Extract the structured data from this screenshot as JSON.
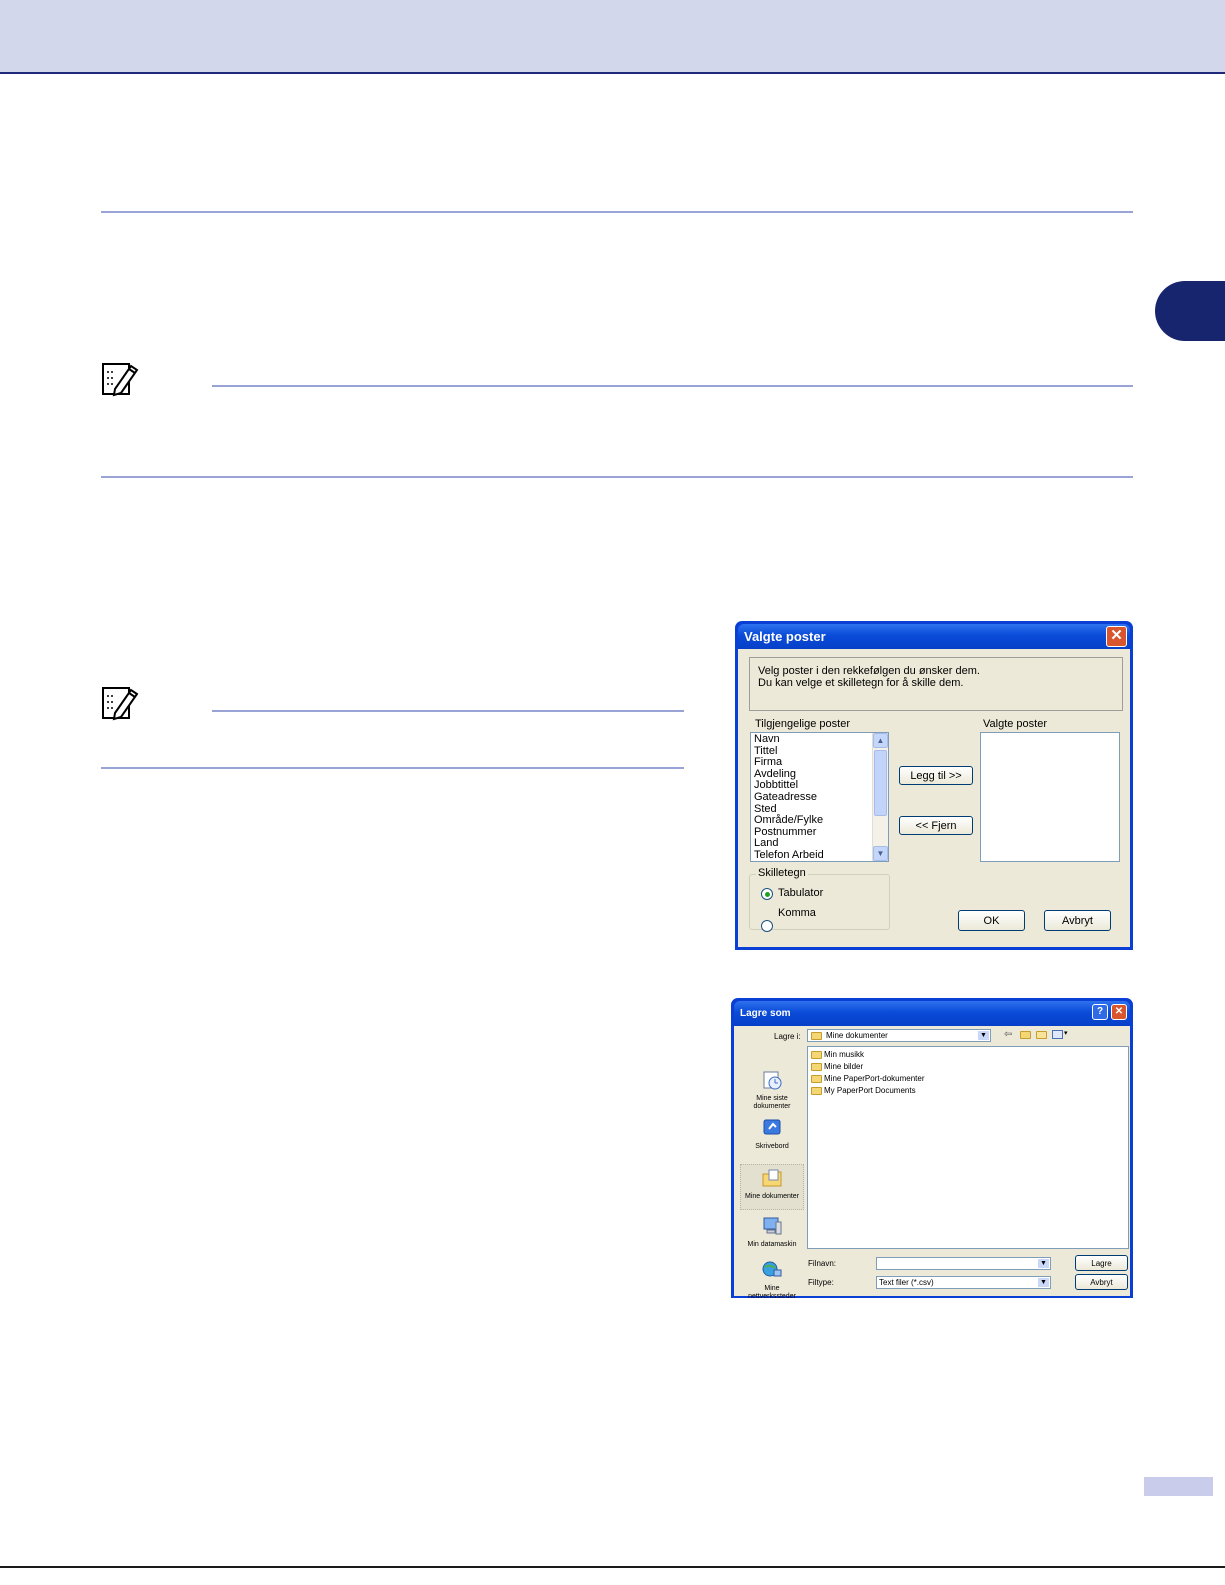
{
  "dialog_valgte_poster": {
    "title": "Valgte poster",
    "info_line1": "Velg poster i den rekkefølgen du ønsker dem.",
    "info_line2": "Du kan velge et skilletegn for å skille dem.",
    "available_label": "Tilgjengelige poster",
    "selected_label": "Valgte poster",
    "available_items": [
      "Navn",
      "Tittel",
      "Firma",
      "Avdeling",
      "Jobbtittel",
      "Gateadresse",
      "Sted",
      "Område/Fylke",
      "Postnummer",
      "Land",
      "Telefon Arbeid"
    ],
    "add_button": "Legg til >>",
    "remove_button": "<< Fjern",
    "separator_group": "Skilletegn",
    "radio_tab": "Tabulator",
    "radio_comma": "Komma",
    "selected_radio": "Tabulator",
    "ok_button": "OK",
    "cancel_button": "Avbryt",
    "close_glyph": "✕"
  },
  "dialog_lagre_som": {
    "title": "Lagre som",
    "save_in_label": "Lagre i:",
    "save_in_value": "Mine dokumenter",
    "places": [
      {
        "label": "Mine siste dokumenter",
        "icon": "recent-documents-icon"
      },
      {
        "label": "Skrivebord",
        "icon": "desktop-icon"
      },
      {
        "label": "Mine dokumenter",
        "icon": "my-documents-icon"
      },
      {
        "label": "Min datamaskin",
        "icon": "my-computer-icon"
      },
      {
        "label": "Mine nettverkssteder",
        "icon": "network-places-icon"
      }
    ],
    "files": [
      "Min musikk",
      "Mine bilder",
      "Mine PaperPort-dokumenter",
      "My PaperPort Documents"
    ],
    "filename_label": "Filnavn:",
    "filename_value": "",
    "filetype_label": "Filtype:",
    "filetype_value": "Text filer (*.csv)",
    "save_button": "Lagre",
    "cancel_button": "Avbryt",
    "help_glyph": "?",
    "close_glyph": "✕"
  },
  "colors": {
    "header_band": "#d3d7ec",
    "chapter_tab": "#17256e",
    "rule": "#9aa3d6"
  }
}
